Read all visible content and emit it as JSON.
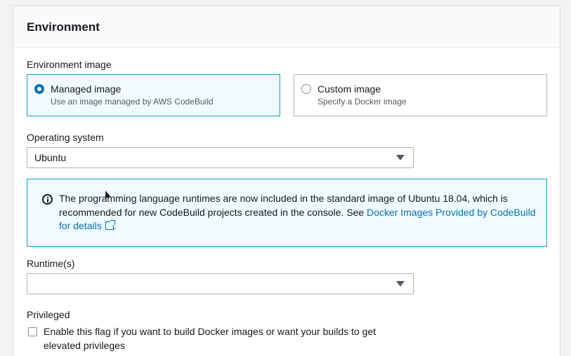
{
  "panel": {
    "title": "Environment"
  },
  "environment_image": {
    "label": "Environment image",
    "options": [
      {
        "title": "Managed image",
        "description": "Use an image managed by AWS CodeBuild",
        "selected": true
      },
      {
        "title": "Custom image",
        "description": "Specify a Docker image",
        "selected": false
      }
    ]
  },
  "operating_system": {
    "label": "Operating system",
    "value": "Ubuntu"
  },
  "info": {
    "text": "The programming language runtimes are now included in the standard image of Ubuntu 18.04, which is recommended for new CodeBuild projects created in the console. See ",
    "link_text": "Docker Images Provided by CodeBuild for details",
    "suffix": "."
  },
  "runtimes": {
    "label": "Runtime(s)",
    "value": ""
  },
  "privileged": {
    "label": "Privileged",
    "checkbox_label": "Enable this flag if you want to build Docker images or want your builds to get elevated privileges",
    "checked": false
  },
  "colors": {
    "accent": "#0073bb",
    "info_border": "#00a1c9",
    "info_bg": "#f1faff"
  }
}
